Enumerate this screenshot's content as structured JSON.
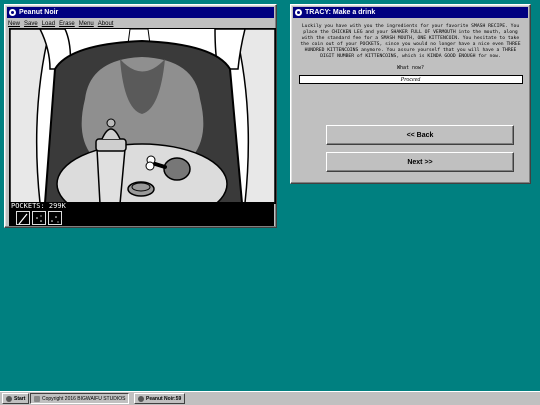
{
  "game": {
    "title": "Peanut Noir",
    "menu": [
      "New",
      "Save",
      "Load",
      "Erase",
      "Menu",
      "About"
    ],
    "pockets": "POCKETS: 299K"
  },
  "dialog": {
    "title": "TRACY: Make a drink",
    "story": "Luckily you have with you the ingredients for your favorite SMASH RECIPE. You place the CHICKEN LEG and your SHAKER FULL OF VERMOUTH into the mouth, along with the standard fee for a SMASH MOUTH, ONE KITTENCOIN. You hesitate to take the coin out of your POCKETS, since you would no longer have a nice even THREE HUNDRED KITTENCOINS anymore. You assure yourself that you will have a THREE DIGIT NUMBER of KITTENCOINS, which is KINDA GOOD ENOUGH for now.",
    "prompt": "What now?",
    "command_value": "Proceed",
    "back_label": "<< Back",
    "next_label": "Next >>"
  },
  "taskbar": {
    "start": "Start",
    "copyright": "Copyright 2016 BIGWAIFU STUDIOS",
    "task": "Peanut Noir:59"
  }
}
